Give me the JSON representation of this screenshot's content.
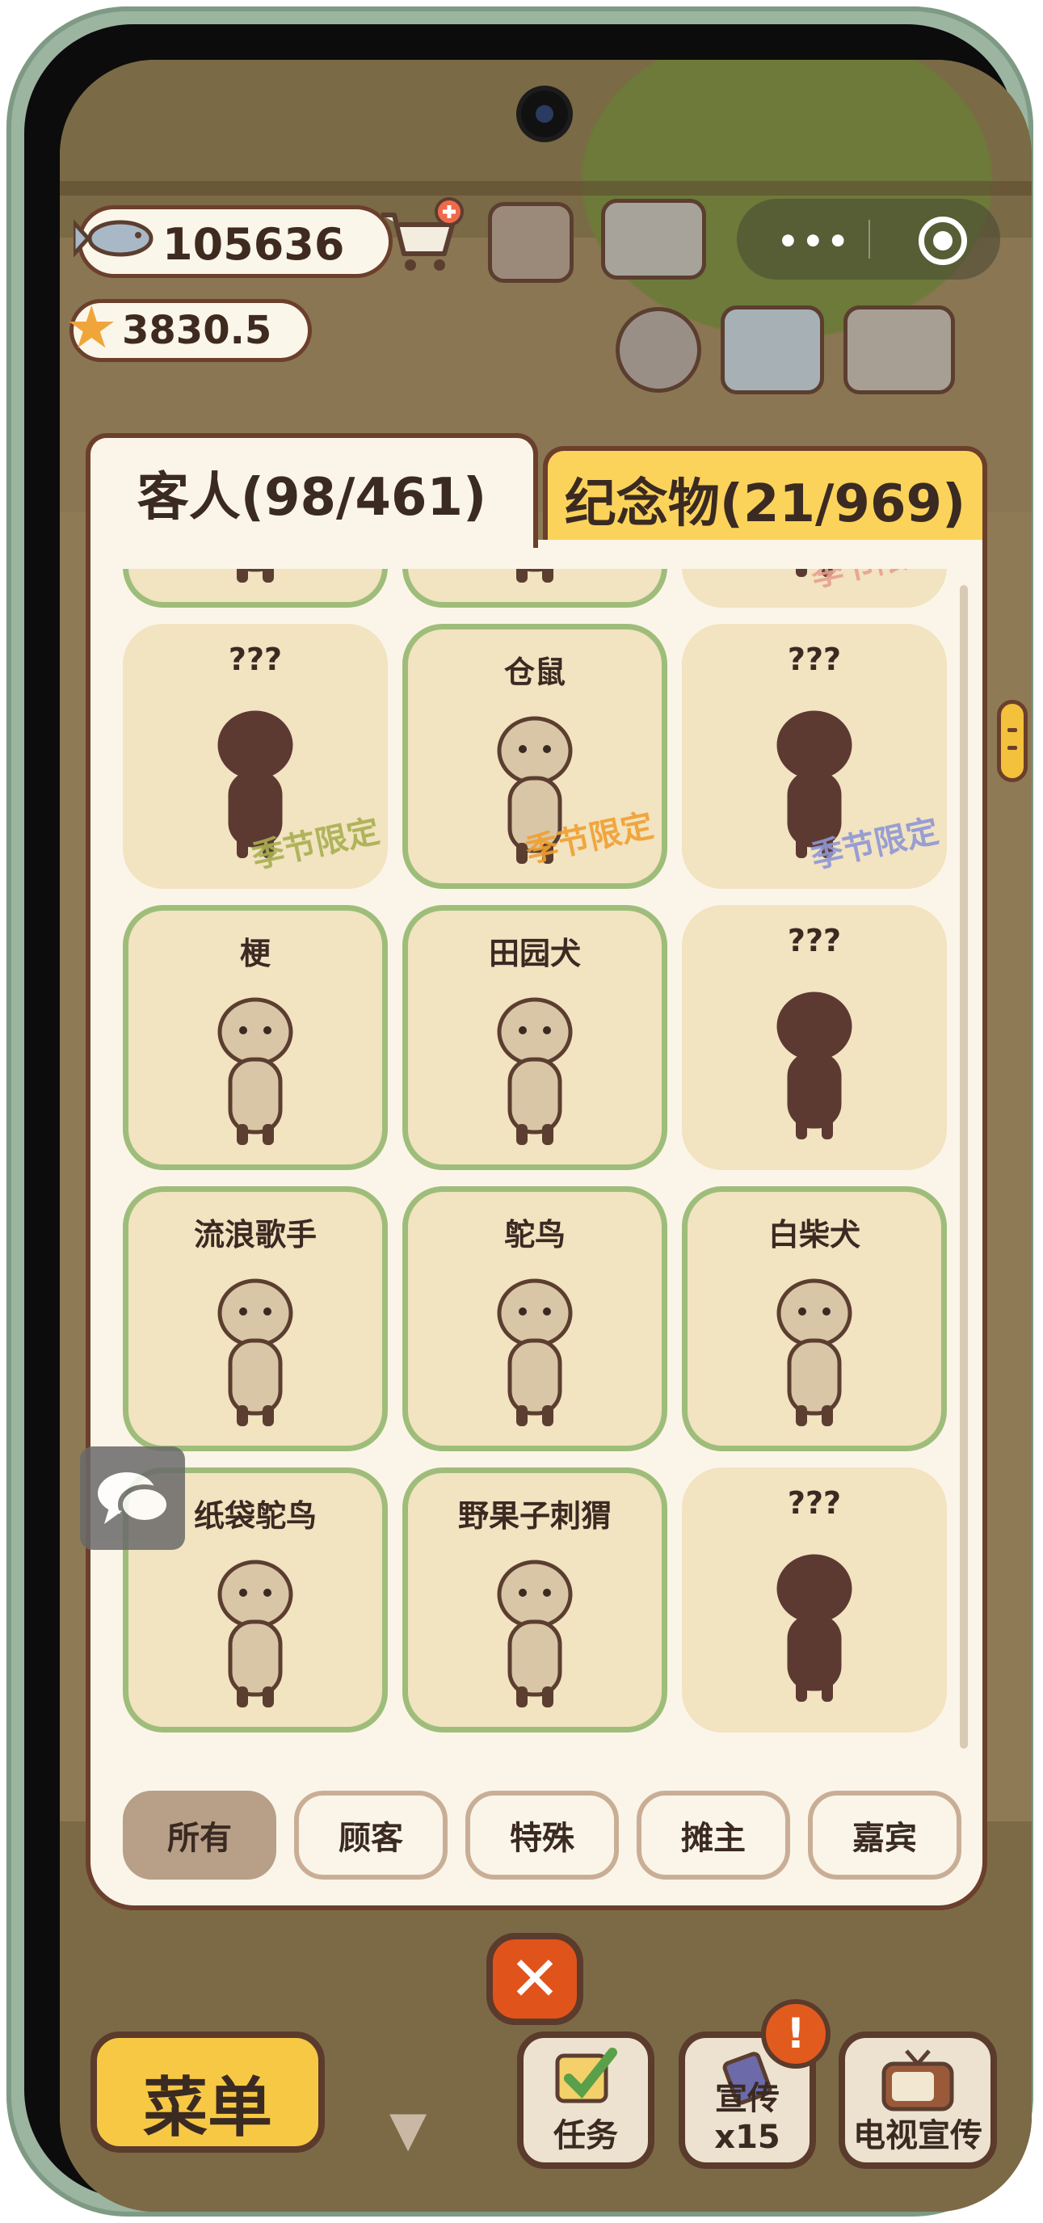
{
  "hud": {
    "fish_count": "105636",
    "star_count": "3830.5"
  },
  "tabs": {
    "guests": "客人(98/461)",
    "souvenirs": "纪念物(21/969)"
  },
  "cards": [
    {
      "name": "",
      "found": true
    },
    {
      "name": "",
      "found": true
    },
    {
      "name": "",
      "found": false,
      "season": "季节限定",
      "season_color": "#e8a18f"
    },
    {
      "name": "???",
      "found": false,
      "season": "季节限定",
      "season_color": "#a8b050"
    },
    {
      "name": "仓鼠",
      "found": true,
      "season": "季节限定",
      "season_color": "#f0a030"
    },
    {
      "name": "???",
      "found": false,
      "season": "季节限定",
      "season_color": "#8f97d4"
    },
    {
      "name": "梗",
      "found": true
    },
    {
      "name": "田园犬",
      "found": true
    },
    {
      "name": "???",
      "found": false
    },
    {
      "name": "流浪歌手",
      "found": true
    },
    {
      "name": "鸵鸟",
      "found": true
    },
    {
      "name": "白柴犬",
      "found": true
    },
    {
      "name": "纸袋鸵鸟",
      "found": true
    },
    {
      "name": "野果子刺猬",
      "found": true
    },
    {
      "name": "???",
      "found": false
    }
  ],
  "filters": [
    "所有",
    "顾客",
    "特殊",
    "摊主",
    "嘉宾"
  ],
  "active_filter": "所有",
  "bottom": {
    "menu_label": "菜单",
    "task_label": "任务",
    "promo_label": "宣传x15",
    "tv_label": "电视宣传",
    "alert_mark": "!"
  },
  "close_symbol": "✕",
  "colors": {
    "border_brown": "#6b3f2c",
    "found_green": "#9fbd7a",
    "tab_yellow": "#fbd35a",
    "silhouette": "#5c3a32"
  }
}
